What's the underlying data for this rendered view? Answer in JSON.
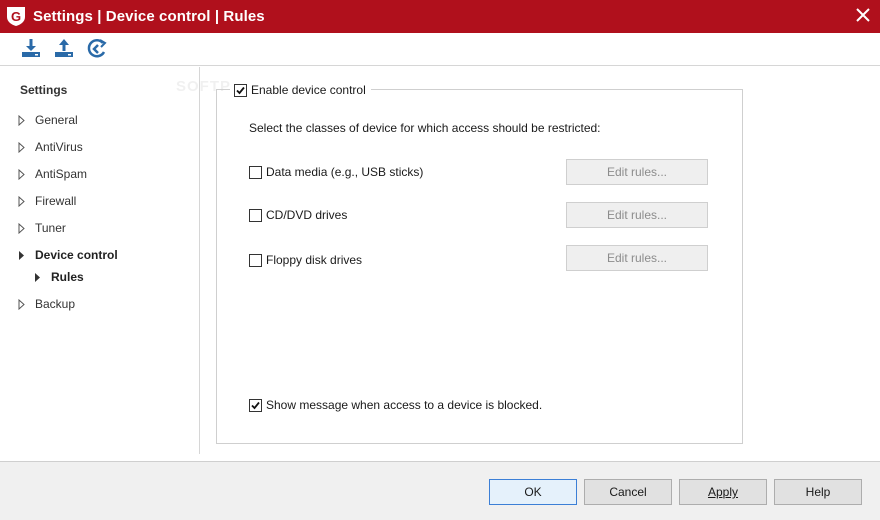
{
  "window": {
    "title": "Settings | Device control | Rules",
    "brand_color": "#b0101c"
  },
  "toolbar": {
    "buttons": [
      {
        "icon": "import-icon"
      },
      {
        "icon": "export-icon"
      },
      {
        "icon": "restore-defaults-icon"
      }
    ]
  },
  "sidebar": {
    "heading": "Settings",
    "items": [
      {
        "label": "General"
      },
      {
        "label": "AntiVirus"
      },
      {
        "label": "AntiSpam"
      },
      {
        "label": "Firewall"
      },
      {
        "label": "Tuner"
      },
      {
        "label": "Device control"
      },
      {
        "label": "Rules"
      },
      {
        "label": "Backup"
      }
    ]
  },
  "main": {
    "enable_label": "Enable device control",
    "enable_checked": true,
    "instruction": "Select the classes of device for which access should be restricted:",
    "devices": [
      {
        "label": "Data media (e.g., USB sticks)",
        "checked": false,
        "button": "Edit rules..."
      },
      {
        "label": "CD/DVD drives",
        "checked": false,
        "button": "Edit rules..."
      },
      {
        "label": "Floppy disk drives",
        "checked": false,
        "button": "Edit rules..."
      }
    ],
    "show_message_label": "Show message when access to a device is blocked.",
    "show_message_checked": true
  },
  "footer": {
    "ok": "OK",
    "cancel": "Cancel",
    "apply": "Apply",
    "help": "Help"
  },
  "watermark": "SOFTPEDIA"
}
